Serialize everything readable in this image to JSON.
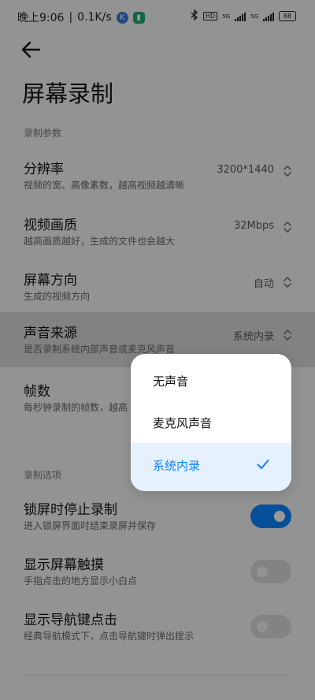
{
  "status_bar": {
    "time": "晚上9:06",
    "net_speed": "0.1K/s",
    "app_icons": [
      "k-app-icon",
      "shield-app-icon"
    ],
    "sim1": "5G",
    "sim2": "5G",
    "battery": "88",
    "indicators": [
      "bluetooth-icon",
      "hd-icon",
      "signal-icon",
      "signal-icon",
      "battery-icon"
    ]
  },
  "header": {
    "title": "屏幕录制",
    "back_icon": "back-arrow-icon"
  },
  "sections": {
    "params_label": "录制参数",
    "options_label": "录制选项"
  },
  "params": [
    {
      "title": "分辨率",
      "subtitle": "视频的宽、高像素数，越高视频越清晰",
      "value": "3200*1440"
    },
    {
      "title": "视频画质",
      "subtitle": "越高画质越好，生成的文件也会越大",
      "value": "32Mbps"
    },
    {
      "title": "屏幕方向",
      "subtitle": "生成的视频方向",
      "value": "自动"
    },
    {
      "title": "声音来源",
      "subtitle": "是否录制系统内部声音或麦克风声音",
      "value": "系统内录"
    },
    {
      "title": "帧数",
      "subtitle": "每秒钟录制的帧数，越高",
      "value": ""
    }
  ],
  "options": [
    {
      "title": "锁屏时停止录制",
      "subtitle": "进入锁屏界面时结束录屏并保存",
      "enabled": true
    },
    {
      "title": "显示屏幕触摸",
      "subtitle": "手指点击的地方显示小白点",
      "enabled": false
    },
    {
      "title": "显示导航键点击",
      "subtitle": "经典导航模式下，点击导航键时弹出提示",
      "enabled": false
    }
  ],
  "popup": {
    "options": [
      "无声音",
      "麦克风声音",
      "系统内录"
    ],
    "selected": "系统内录",
    "check_icon": "checkmark-icon"
  },
  "colors": {
    "accent": "#0d84ff",
    "selected_bg": "#e6f1ff",
    "background": "#f5f5f5"
  }
}
